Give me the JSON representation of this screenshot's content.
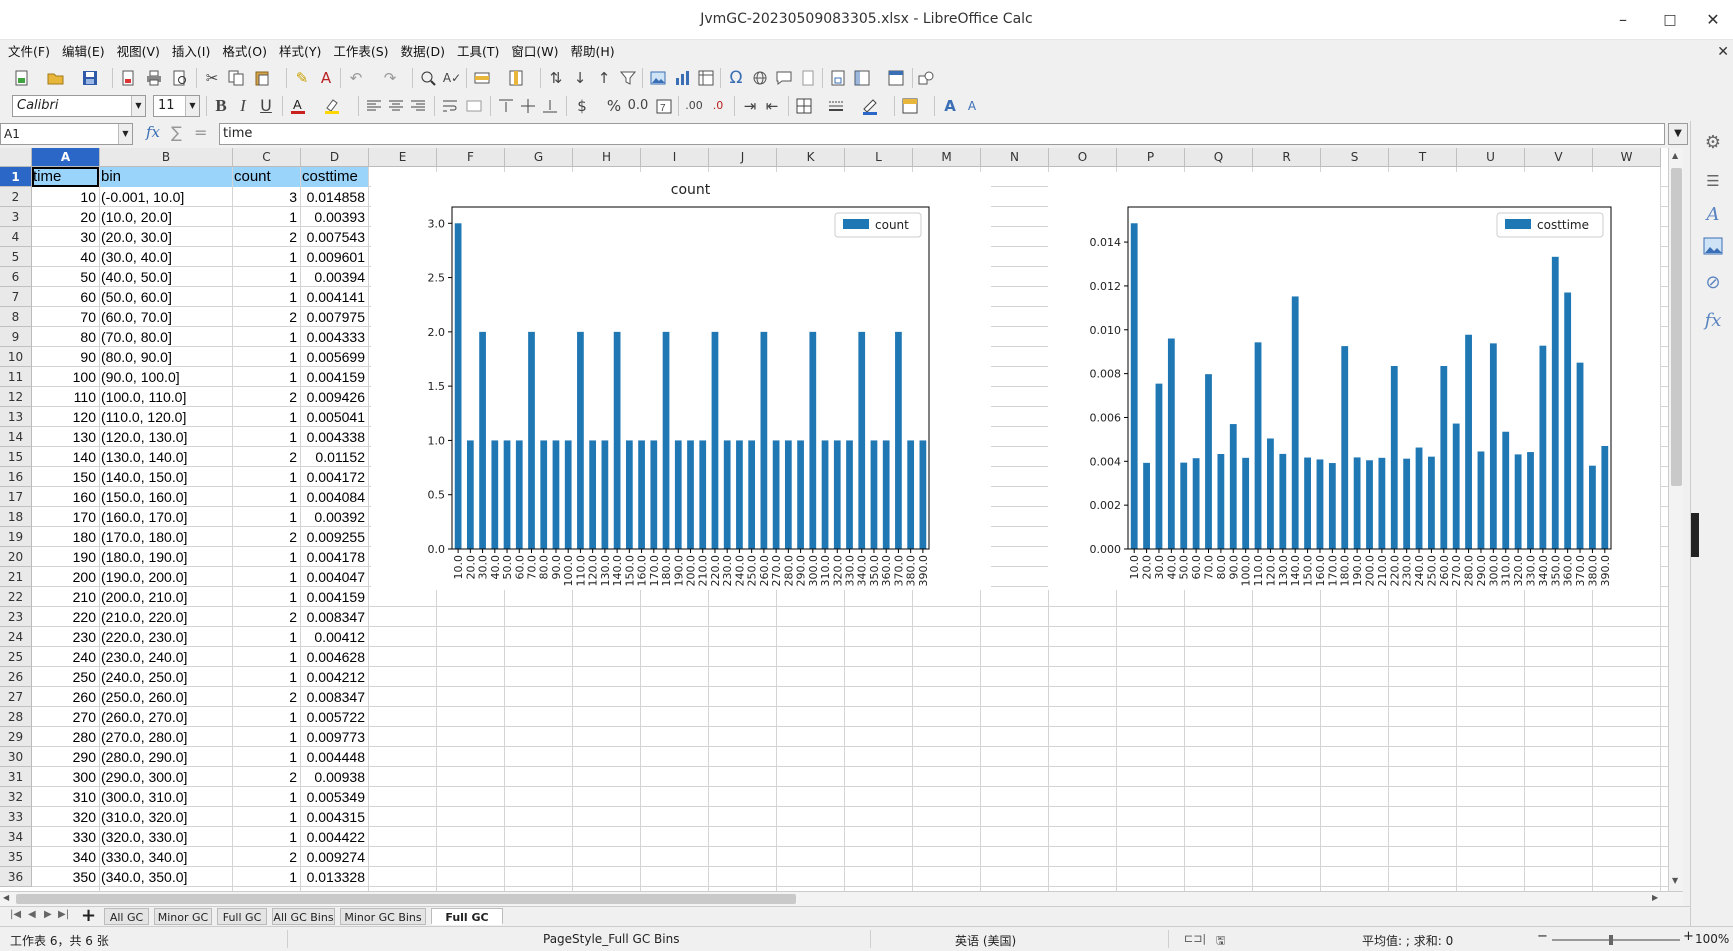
{
  "window": {
    "title": "JvmGC-20230509083305.xlsx - LibreOffice Calc",
    "min_glyph": "–",
    "max_glyph": "□",
    "close_glyph": "✕"
  },
  "menu": [
    "文件(F)",
    "编辑(E)",
    "视图(V)",
    "插入(I)",
    "格式(O)",
    "样式(Y)",
    "工作表(S)",
    "数据(D)",
    "工具(T)",
    "窗口(W)",
    "帮助(H)"
  ],
  "font_toolbar": {
    "font_name": "Calibri",
    "font_size": "11",
    "bold": "B",
    "italic": "I",
    "underline": "U",
    "currency": "$",
    "percent": "%",
    "number": "0.0"
  },
  "formula_bar": {
    "cell_ref": "A1",
    "fx": "fx",
    "sum": "∑",
    "equals": "=",
    "content": "time"
  },
  "columns": [
    "A",
    "B",
    "C",
    "D",
    "E",
    "F",
    "G",
    "H",
    "I",
    "J",
    "K",
    "L",
    "M",
    "N",
    "O",
    "P",
    "Q",
    "R",
    "S",
    "T",
    "U",
    "V",
    "W"
  ],
  "header_row": {
    "a": "time",
    "b": "bin",
    "c": "count",
    "d": "costtime"
  },
  "rows": [
    {
      "n": "1"
    },
    {
      "n": "2",
      "a": "10",
      "b": "(-0.001, 10.0]",
      "c": "3",
      "d": "0.014858"
    },
    {
      "n": "3",
      "a": "20",
      "b": "(10.0, 20.0]",
      "c": "1",
      "d": "0.00393"
    },
    {
      "n": "4",
      "a": "30",
      "b": "(20.0, 30.0]",
      "c": "2",
      "d": "0.007543"
    },
    {
      "n": "5",
      "a": "40",
      "b": "(30.0, 40.0]",
      "c": "1",
      "d": "0.009601"
    },
    {
      "n": "6",
      "a": "50",
      "b": "(40.0, 50.0]",
      "c": "1",
      "d": "0.00394"
    },
    {
      "n": "7",
      "a": "60",
      "b": "(50.0, 60.0]",
      "c": "1",
      "d": "0.004141"
    },
    {
      "n": "8",
      "a": "70",
      "b": "(60.0, 70.0]",
      "c": "2",
      "d": "0.007975"
    },
    {
      "n": "9",
      "a": "80",
      "b": "(70.0, 80.0]",
      "c": "1",
      "d": "0.004333"
    },
    {
      "n": "10",
      "a": "90",
      "b": "(80.0, 90.0]",
      "c": "1",
      "d": "0.005699"
    },
    {
      "n": "11",
      "a": "100",
      "b": "(90.0, 100.0]",
      "c": "1",
      "d": "0.004159"
    },
    {
      "n": "12",
      "a": "110",
      "b": "(100.0, 110.0]",
      "c": "2",
      "d": "0.009426"
    },
    {
      "n": "13",
      "a": "120",
      "b": "(110.0, 120.0]",
      "c": "1",
      "d": "0.005041"
    },
    {
      "n": "14",
      "a": "130",
      "b": "(120.0, 130.0]",
      "c": "1",
      "d": "0.004338"
    },
    {
      "n": "15",
      "a": "140",
      "b": "(130.0, 140.0]",
      "c": "2",
      "d": "0.01152"
    },
    {
      "n": "16",
      "a": "150",
      "b": "(140.0, 150.0]",
      "c": "1",
      "d": "0.004172"
    },
    {
      "n": "17",
      "a": "160",
      "b": "(150.0, 160.0]",
      "c": "1",
      "d": "0.004084"
    },
    {
      "n": "18",
      "a": "170",
      "b": "(160.0, 170.0]",
      "c": "1",
      "d": "0.00392"
    },
    {
      "n": "19",
      "a": "180",
      "b": "(170.0, 180.0]",
      "c": "2",
      "d": "0.009255"
    },
    {
      "n": "20",
      "a": "190",
      "b": "(180.0, 190.0]",
      "c": "1",
      "d": "0.004178"
    },
    {
      "n": "21",
      "a": "200",
      "b": "(190.0, 200.0]",
      "c": "1",
      "d": "0.004047"
    },
    {
      "n": "22",
      "a": "210",
      "b": "(200.0, 210.0]",
      "c": "1",
      "d": "0.004159"
    },
    {
      "n": "23",
      "a": "220",
      "b": "(210.0, 220.0]",
      "c": "2",
      "d": "0.008347"
    },
    {
      "n": "24",
      "a": "230",
      "b": "(220.0, 230.0]",
      "c": "1",
      "d": "0.00412"
    },
    {
      "n": "25",
      "a": "240",
      "b": "(230.0, 240.0]",
      "c": "1",
      "d": "0.004628"
    },
    {
      "n": "26",
      "a": "250",
      "b": "(240.0, 250.0]",
      "c": "1",
      "d": "0.004212"
    },
    {
      "n": "27",
      "a": "260",
      "b": "(250.0, 260.0]",
      "c": "2",
      "d": "0.008347"
    },
    {
      "n": "28",
      "a": "270",
      "b": "(260.0, 270.0]",
      "c": "1",
      "d": "0.005722"
    },
    {
      "n": "29",
      "a": "280",
      "b": "(270.0, 280.0]",
      "c": "1",
      "d": "0.009773"
    },
    {
      "n": "30",
      "a": "290",
      "b": "(280.0, 290.0]",
      "c": "1",
      "d": "0.004448"
    },
    {
      "n": "31",
      "a": "300",
      "b": "(290.0, 300.0]",
      "c": "2",
      "d": "0.00938"
    },
    {
      "n": "32",
      "a": "310",
      "b": "(300.0, 310.0]",
      "c": "1",
      "d": "0.005349"
    },
    {
      "n": "33",
      "a": "320",
      "b": "(310.0, 320.0]",
      "c": "1",
      "d": "0.004315"
    },
    {
      "n": "34",
      "a": "330",
      "b": "(320.0, 330.0]",
      "c": "1",
      "d": "0.004422"
    },
    {
      "n": "35",
      "a": "340",
      "b": "(330.0, 340.0]",
      "c": "2",
      "d": "0.009274"
    },
    {
      "n": "36",
      "a": "350",
      "b": "(340.0, 350.0]",
      "c": "1",
      "d": "0.013328"
    }
  ],
  "chart_data": [
    {
      "type": "bar",
      "title": "count",
      "legend": "count",
      "legend_position": "top-right",
      "color": "#1f77b4",
      "categories": [
        "10.0",
        "20.0",
        "30.0",
        "40.0",
        "50.0",
        "60.0",
        "70.0",
        "80.0",
        "90.0",
        "100.0",
        "110.0",
        "120.0",
        "130.0",
        "140.0",
        "150.0",
        "160.0",
        "170.0",
        "180.0",
        "190.0",
        "200.0",
        "210.0",
        "220.0",
        "230.0",
        "240.0",
        "250.0",
        "260.0",
        "270.0",
        "280.0",
        "290.0",
        "300.0",
        "310.0",
        "320.0",
        "330.0",
        "340.0",
        "350.0",
        "360.0",
        "370.0",
        "380.0",
        "390.0"
      ],
      "values": [
        3,
        1,
        2,
        1,
        1,
        1,
        2,
        1,
        1,
        1,
        2,
        1,
        1,
        2,
        1,
        1,
        1,
        2,
        1,
        1,
        1,
        2,
        1,
        1,
        1,
        2,
        1,
        1,
        1,
        2,
        1,
        1,
        1,
        2,
        1,
        1,
        2,
        1,
        1
      ],
      "ylim": [
        0,
        3.15
      ],
      "yticks": [
        "0.0",
        "0.5",
        "1.0",
        "1.5",
        "2.0",
        "2.5",
        "3.0"
      ]
    },
    {
      "type": "bar",
      "title": "",
      "legend": "costtime",
      "legend_position": "top-right",
      "color": "#1f77b4",
      "categories": [
        "10.0",
        "20.0",
        "30.0",
        "40.0",
        "50.0",
        "60.0",
        "70.0",
        "80.0",
        "90.0",
        "100.0",
        "110.0",
        "120.0",
        "130.0",
        "140.0",
        "150.0",
        "160.0",
        "170.0",
        "180.0",
        "190.0",
        "200.0",
        "210.0",
        "220.0",
        "230.0",
        "240.0",
        "250.0",
        "260.0",
        "270.0",
        "280.0",
        "290.0",
        "300.0",
        "310.0",
        "320.0",
        "330.0",
        "340.0",
        "350.0",
        "360.0",
        "370.0",
        "380.0",
        "390.0"
      ],
      "values": [
        0.014858,
        0.00393,
        0.007543,
        0.009601,
        0.00394,
        0.004141,
        0.007975,
        0.004333,
        0.005699,
        0.004159,
        0.009426,
        0.005041,
        0.004338,
        0.01152,
        0.004172,
        0.004084,
        0.00392,
        0.009255,
        0.004178,
        0.004047,
        0.004159,
        0.008347,
        0.00412,
        0.004628,
        0.004212,
        0.008347,
        0.005722,
        0.009773,
        0.004448,
        0.00938,
        0.005349,
        0.004315,
        0.004422,
        0.009274,
        0.013328,
        0.0117,
        0.0085,
        0.0038,
        0.0047
      ],
      "ylim": [
        0,
        0.0156
      ],
      "yticks": [
        "0.000",
        "0.002",
        "0.004",
        "0.006",
        "0.008",
        "0.010",
        "0.012",
        "0.014"
      ]
    }
  ],
  "tabs": [
    "All GC",
    "Minor GC",
    "Full GC",
    "All GC Bins",
    "Minor GC Bins",
    "Full GC Bins"
  ],
  "tab_add": "+",
  "status": {
    "sheet": "工作表 6，共 6 张",
    "page_style": "PageStyle_Full GC Bins",
    "language": "英语 (美国)",
    "summary": "平均值: ; 求和: 0",
    "zoom": "100%"
  },
  "accent": "#2a67c6",
  "header_fill": "#9ad4fb"
}
